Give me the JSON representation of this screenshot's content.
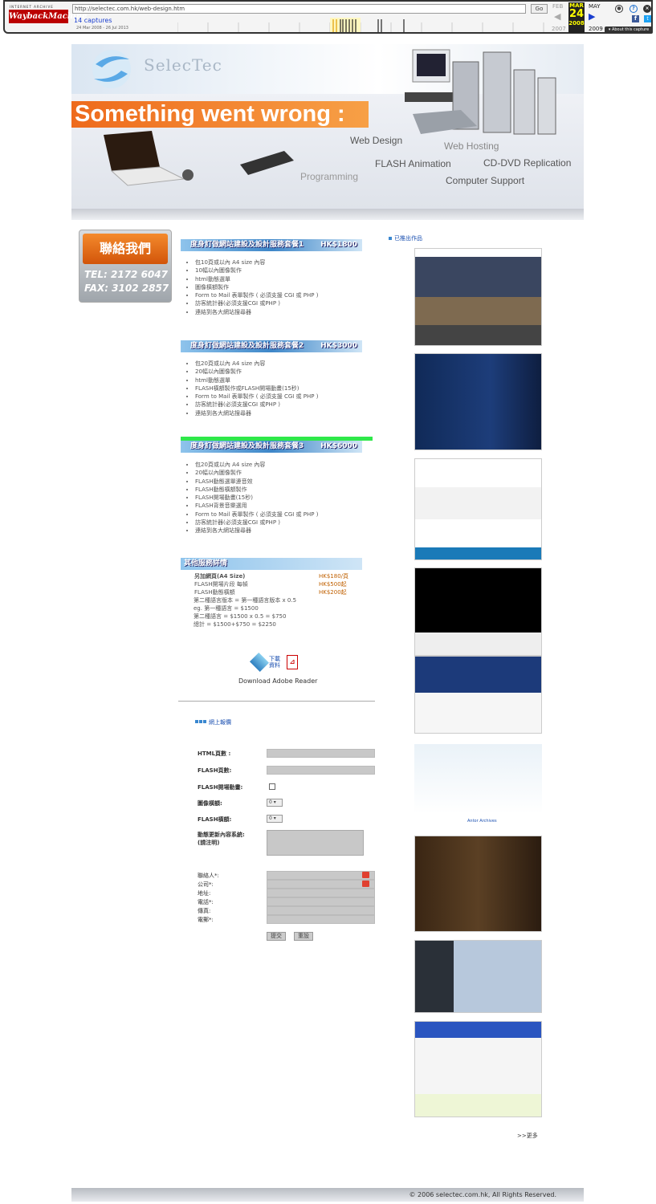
{
  "wayback": {
    "logo_top": "INTERNET ARCHIVE",
    "logo": "WaybackMachine",
    "url": "http://selectec.com.hk/web-design.htm",
    "go": "Go",
    "captures": "14 captures",
    "range": "24 Mar 2008 - 26 Jul 2013",
    "prev_month": "FEB",
    "cur_month": "MAR",
    "cur_day": "24",
    "cur_year": "2008",
    "next_month": "MAY",
    "prev_year": "2007",
    "next_year": "2009",
    "about": "About this capture"
  },
  "banner": {
    "logo": "SelecTec",
    "error": "Something went wrong :",
    "services": [
      "Web Design",
      "Web Hosting",
      "FLASH Animation",
      "CD-DVD Replication",
      "Programming",
      "Computer Support"
    ]
  },
  "contact": {
    "button": "聯絡我們",
    "tel": "TEL: 2172 6047",
    "fax": "FAX: 3102 2857"
  },
  "plans": [
    {
      "title": "度身訂做網站建設及設計服務套餐1",
      "price": "HK$1800",
      "items": [
        "包10頁或以內 A4 size 內容",
        "10幅以內圖像製作",
        "html動態選單",
        "圖像橫額製作",
        "Form to Mail 表單製作 ( 必須支援 CGI 或 PHP )",
        "訪客統計器(必須支援CGI 或PHP )",
        "連結到各大網站搜尋器"
      ]
    },
    {
      "title": "度身訂做網站建設及設計服務套餐2",
      "price": "HK$3000",
      "items": [
        "包20頁或以內 A4 size 內容",
        "20幅以內圖像製作",
        "html動態選單",
        "FLASH橫額製作或FLASH開場動畫(15秒)",
        "Form to Mail 表單製作 ( 必須支援 CGI 或 PHP )",
        "訪客統計器(必須支援CGI 或PHP )",
        "連結到各大網站搜尋器"
      ]
    },
    {
      "title": "度身訂做網站建設及設計服務套餐3",
      "price": "HK$6000",
      "items": [
        "包20頁或以內 A4 size 內容",
        "20幅以內圖像製作",
        "FLASH動態選單連音效",
        "FLASH動態橫額製作",
        "FLASH開場動畫(15秒)",
        "FLASH背景音樂選用",
        "Form to Mail 表單製作 ( 必須支援 CGI 或 PHP )",
        "訪客統計器(必須支援CGI 或PHP )",
        "連結到各大網站搜尋器"
      ]
    }
  ],
  "other": {
    "title": "其他服務詳情",
    "rows": [
      {
        "label": "另加網頁(A4 Size)",
        "price": "HK$180/頁"
      },
      {
        "label": "FLASH開場片段 每幀",
        "price": "HK$500起"
      },
      {
        "label": "FLASH動態橫額",
        "price": "HK$200起"
      }
    ],
    "notes": [
      "第二種語言版本 = 第一種語言版本 x 0.5",
      "eg. 第一種語言 = $1500",
      "第二種語言 = $1500 x 0.5 = $750",
      "總計 = $1500+$750 = $2250"
    ]
  },
  "download": {
    "label": "下載資料",
    "reader": "Download Adobe Reader"
  },
  "quote": {
    "title": "網上報價",
    "html_pages": "HTML頁數 :",
    "flash_pages": "FLASH頁數:",
    "flash_intro": "FLASH開場動畫:",
    "image_banner": "圖像橫額:",
    "flash_banner": "FLASH橫額:",
    "cms": "動態更新內容系統:",
    "cms_note": "(請注明)",
    "select_value": "0",
    "contact": "聯絡人*:",
    "company": "公司*:",
    "address": "地址:",
    "phone": "電話*:",
    "fax": "傳真:",
    "email": "電郵*:",
    "submit": "提交",
    "reset": "重設"
  },
  "portfolio": {
    "title": "已推出作品",
    "more": ">>更多",
    "caption_antor": "Antor Archives"
  },
  "footer": "© 2006 selectec.com.hk, All Rights Reserved."
}
